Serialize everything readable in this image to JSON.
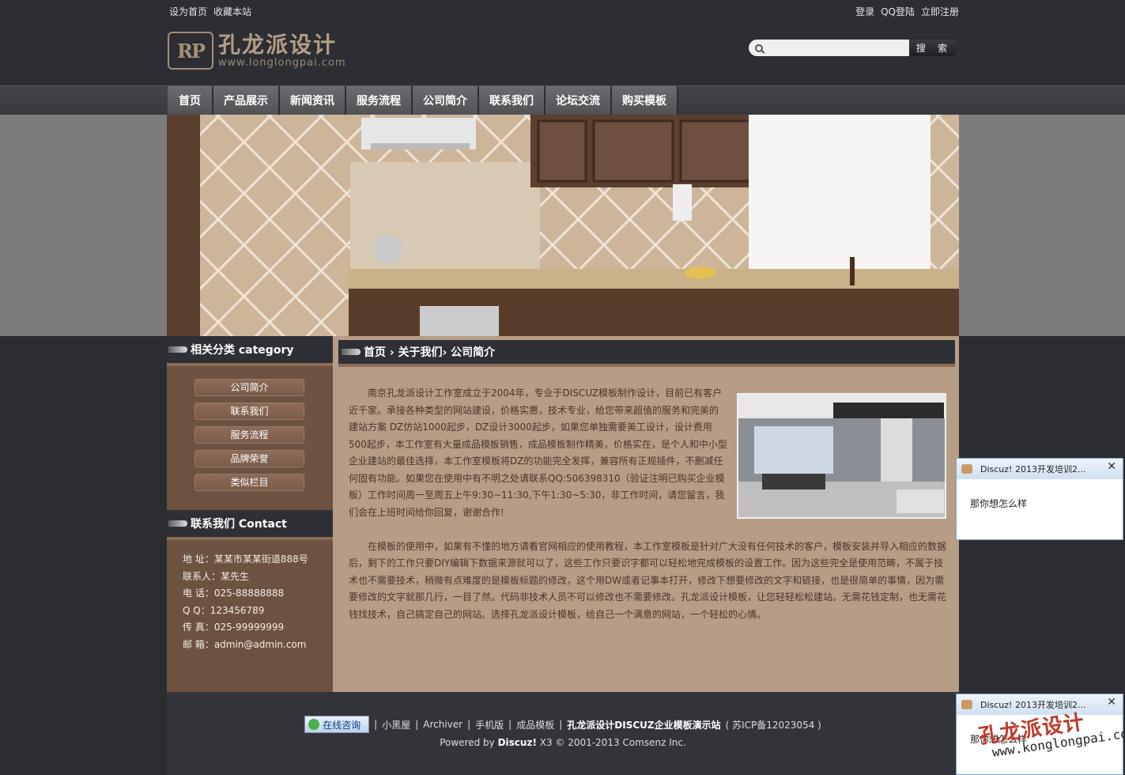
{
  "header": {
    "top_left": [
      "设为首页",
      "收藏本站"
    ],
    "top_right": [
      "登录",
      "QQ登陆",
      "立即注册"
    ],
    "logo_mark": "RP",
    "logo_text": "孔龙派设计",
    "logo_url": "www.longlongpai.com",
    "search_placeholder": "",
    "search_button": "搜 索"
  },
  "nav": [
    "首页",
    "产品展示",
    "新闻资讯",
    "服务流程",
    "公司简介",
    "联系我们",
    "论坛交流",
    "购买模板"
  ],
  "sidebar": {
    "category_title": "相关分类 category",
    "categories": [
      "公司简介",
      "联系我们",
      "服务流程",
      "品牌荣誉",
      "类似栏目"
    ],
    "contact_title": "联系我们 Contact",
    "contact": [
      "地  址：某某市某某街道888号",
      "联系人：某先生",
      "电  话：025-88888888",
      "Q  Q：123456789",
      "传  真：025-99999999",
      "邮  箱：admin@admin.com"
    ]
  },
  "content": {
    "breadcrumb": "首页 › 关于我们› 公司简介",
    "para1": "南京孔龙派设计工作室成立于2004年，专业于DISCUZ模板制作设计，目前已有客户近千家。承接各种类型的网站建设，价格实惠，技术专业，给您带来超值的服务和完美的建站方案 DZ仿站1000起步，DZ设计3000起步，如果您单独需要美工设计，设计费用500起步，本工作室有大量成品模板销售，成品模板制作精美，价格实在，是个人和中小型企业建站的最佳选择，本工作室模板将DZ的功能完全发挥，兼容所有正规插件，不删减任何固有功能。如果您在使用中有不明之处请联系QQ:506398310（验证注明已购买企业模板）工作时间周一至周五上午9:30~11:30,下午1:30~5:30，非工作时间，请您留言，我们会在上班时间给你回复，谢谢合作!",
    "para2": "在模板的使用中，如果有不懂的地方请看官网相应的使用教程，本工作室模板是针对广大没有任何技术的客户，模板安装并导入相应的数据后，剩下的工作只要DIY编辑下数据来源就可以了，这些工作只要识字都可以轻松地完成模板的设置工作。因为这些完全是使用范畴，不属于技术也不需要技术，稍微有点难度的是模板标题的修改，这个用DW或者记事本打开，修改下想要修改的文字和链接，也是很简单的事情，因为需要修改的文字就那几行，一目了然。代码非技术人员不可以修改也不需要修改。孔龙派设计模板，让您轻轻松松建站。无需花钱定制，也无需花钱找技术，自己搞定自己的网站。选择孔龙派设计模板，给自己一个满意的网站，一个轻松的心情。"
  },
  "footer": {
    "kefu": "在线咨询",
    "links": [
      "小黑屋",
      "Archiver",
      "手机版",
      "成品模板"
    ],
    "site_name": "孔龙派设计DISCUZ企业模板演示站",
    "icp": "( 苏ICP备12023054 )",
    "powered_prefix": "Powered by ",
    "powered_brand": "Discuz!",
    "powered_suffix": " X3 © 2001-2013 Comsenz Inc."
  },
  "popups": [
    {
      "title": "Discuz! 2013开发培训2...",
      "message": "那你想怎么样"
    },
    {
      "title": "Discuz! 2013开发培训2...",
      "message": "那你想怎么样"
    }
  ],
  "watermark": {
    "cn": "孔龙派设计",
    "url": "www.konglongpai.com"
  },
  "colors": {
    "page_bg": "#2b2d31",
    "sidebar_bg": "#6e5241",
    "content_bg": "#b79d85",
    "accent": "#8b6d57"
  }
}
